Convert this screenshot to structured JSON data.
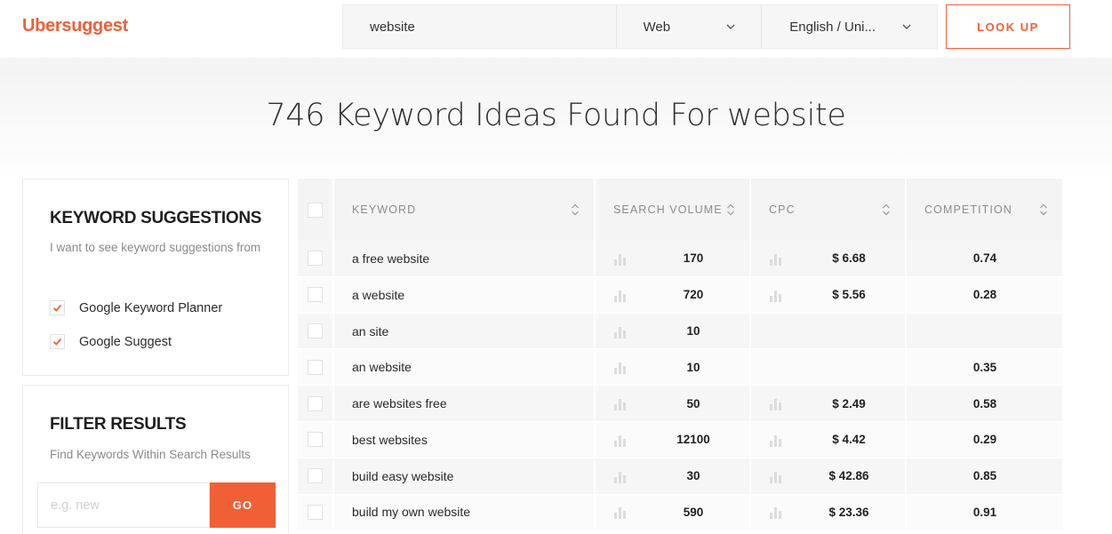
{
  "app": {
    "logo": "Ubersuggest",
    "brand_color": "#f15f37"
  },
  "search": {
    "query": "website",
    "source": "Web",
    "language": "English / Uni...",
    "lookup_label": "LOOK UP"
  },
  "page_title": "746 Keyword Ideas Found For website",
  "sidebar": {
    "suggestions": {
      "title": "KEYWORD SUGGESTIONS",
      "subtitle": "I want to see keyword suggestions from",
      "options": [
        {
          "label": "Google Keyword Planner",
          "checked": true
        },
        {
          "label": "Google Suggest",
          "checked": true
        }
      ]
    },
    "filter": {
      "title": "FILTER RESULTS",
      "subtitle": "Find Keywords Within Search Results",
      "placeholder": "e.g. new",
      "go_label": "GO"
    }
  },
  "table": {
    "columns": [
      "KEYWORD",
      "SEARCH VOLUME",
      "CPC",
      "COMPETITION"
    ],
    "rows": [
      {
        "keyword": "a free website",
        "volume": "170",
        "cpc": "$ 6.68",
        "competition": "0.74"
      },
      {
        "keyword": "a website",
        "volume": "720",
        "cpc": "$ 5.56",
        "competition": "0.28"
      },
      {
        "keyword": "an site",
        "volume": "10",
        "cpc": "",
        "competition": ""
      },
      {
        "keyword": "an website",
        "volume": "10",
        "cpc": "",
        "competition": "0.35"
      },
      {
        "keyword": "are websites free",
        "volume": "50",
        "cpc": "$ 2.49",
        "competition": "0.58"
      },
      {
        "keyword": "best websites",
        "volume": "12100",
        "cpc": "$ 4.42",
        "competition": "0.29"
      },
      {
        "keyword": "build easy website",
        "volume": "30",
        "cpc": "$ 42.86",
        "competition": "0.85"
      },
      {
        "keyword": "build my own website",
        "volume": "590",
        "cpc": "$ 23.36",
        "competition": "0.91"
      }
    ]
  }
}
